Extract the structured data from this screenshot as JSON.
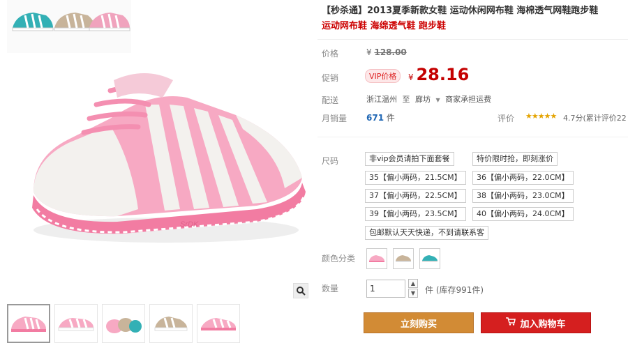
{
  "product": {
    "title": "【秒杀通】2013夏季新款女鞋 运动休闲网布鞋 海棉透气网鞋跑步鞋",
    "subtitle": "运动网布鞋 海绵透气鞋 跑步鞋"
  },
  "labels": {
    "price": "价格",
    "promo": "促销",
    "shipping": "配送",
    "monthly_sales": "月销量",
    "rating": "评价",
    "size": "尺码",
    "color": "颜色分类",
    "quantity": "数量"
  },
  "pricing": {
    "original_currency": "¥",
    "original_value": "128.00",
    "vip_badge": "VIP价格",
    "promo_currency": "¥",
    "promo_value": "28.16"
  },
  "shipping": {
    "from": "浙江温州",
    "connector": "至",
    "to": "廊坊",
    "fee": "商家承担运费"
  },
  "sales": {
    "count": "671",
    "unit": "件"
  },
  "rating": {
    "stars": "★★★★★",
    "score_text": "4.7分(累计评价22"
  },
  "sizes": [
    "非vip会员请拍下面套餐",
    "特价限时抢，即刻涨价",
    "35【偏小两码，21.5CM】",
    "36【偏小两码，22.0CM】",
    "37【偏小两码，22.5CM】",
    "38【偏小两码，23.0CM】",
    "39【偏小两码，23.5CM】",
    "40【偏小两码，24.0CM】",
    "包邮默认天天快递，不到请联系客"
  ],
  "colors": [
    "pink-shoe",
    "beige-shoe",
    "teal-shoe"
  ],
  "quantity": {
    "value": "1",
    "unit_stock": "件 (库存991件)"
  },
  "buttons": {
    "buy_now": "立刻购买",
    "add_to_cart": "加入购物车"
  },
  "icons": {
    "zoom": "magnifier-icon",
    "cart": "cart-icon"
  },
  "theme": {
    "accent_red": "#c40000",
    "buy_orange": "#d28b35",
    "cart_red": "#d51f1f"
  }
}
